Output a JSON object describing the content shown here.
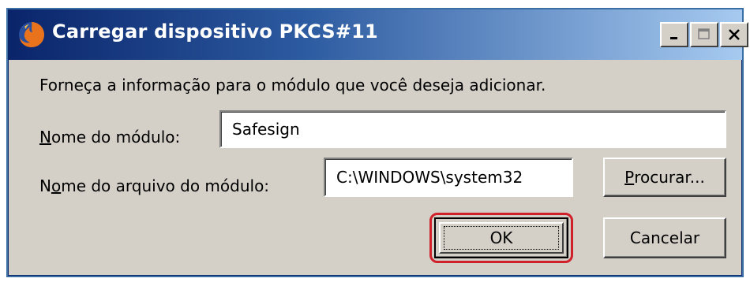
{
  "window": {
    "title": "Carregar dispositivo PKCS#11",
    "icon": "firefox-icon",
    "controls": {
      "minimize": "minimize-icon",
      "maximize": "maximize-icon",
      "close": "close-icon"
    }
  },
  "form": {
    "instruction": "Forneça a informação para o módulo que você deseja adicionar.",
    "module_name": {
      "label_accel": "N",
      "label_rest": "ome do módulo:",
      "value": "Safesign"
    },
    "module_file": {
      "label_pre": "N",
      "label_accel": "o",
      "label_rest": "me do arquivo do módulo:",
      "value": "C:\\WINDOWS\\system32"
    }
  },
  "buttons": {
    "browse_accel": "P",
    "browse_rest": "rocurar...",
    "ok": "OK",
    "cancel": "Cancelar"
  },
  "colors": {
    "titlebar_start": "#0a246a",
    "titlebar_end": "#a6caf0",
    "dialog_bg": "#d4d0c8",
    "highlight": "#d0202a"
  }
}
